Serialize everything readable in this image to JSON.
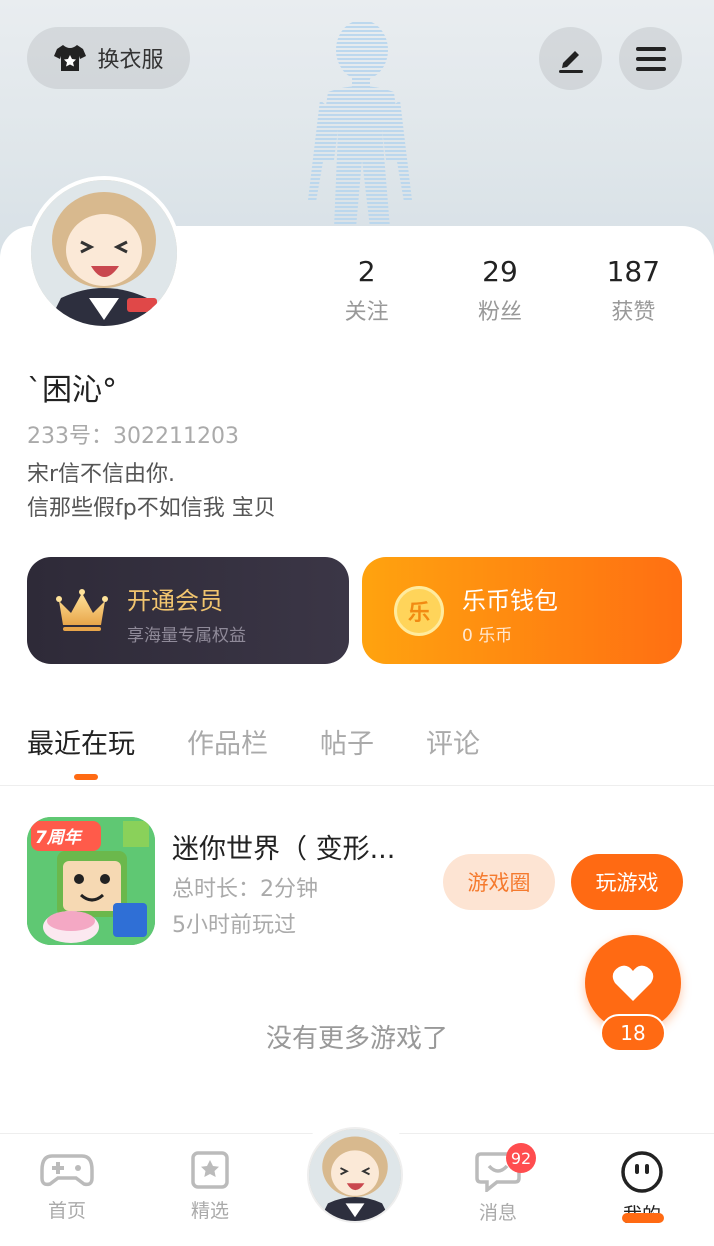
{
  "header": {
    "outfit_label": "换衣服",
    "edit_icon": "pen-icon",
    "menu_icon": "menu-icon"
  },
  "profile": {
    "stats": [
      {
        "value": "2",
        "label": "关注"
      },
      {
        "value": "29",
        "label": "粉丝"
      },
      {
        "value": "187",
        "label": "获赞"
      }
    ],
    "nickname": "`困沁°",
    "uid_label": "233号：302211203",
    "bio_line1": "宋r信不信由你.",
    "bio_line2": "信那些假fp不如信我 宝贝"
  },
  "cards": {
    "vip": {
      "title": "开通会员",
      "subtitle": "享海量专属权益"
    },
    "wallet": {
      "title": "乐币钱包",
      "subtitle": "0 乐币",
      "coin_glyph": "乐"
    }
  },
  "tabs": [
    "最近在玩",
    "作品栏",
    "帖子",
    "评论"
  ],
  "games": [
    {
      "name": "迷你世界（ 变形...",
      "duration": "总时长：2分钟",
      "last_played": "5小时前玩过",
      "badge_text": "7周年",
      "circle_button": "游戏圈",
      "play_button": "玩游戏"
    }
  ],
  "empty_text": "没有更多游戏了",
  "like": {
    "count": "18"
  },
  "nav": {
    "items": [
      {
        "label": "首页"
      },
      {
        "label": "精选"
      },
      {
        "label": "消息",
        "badge": "92"
      },
      {
        "label": "我的"
      }
    ]
  },
  "colors": {
    "accent": "#ff6a13",
    "vip_bg": "#2e2a38",
    "vip_text": "#f2c56f"
  }
}
